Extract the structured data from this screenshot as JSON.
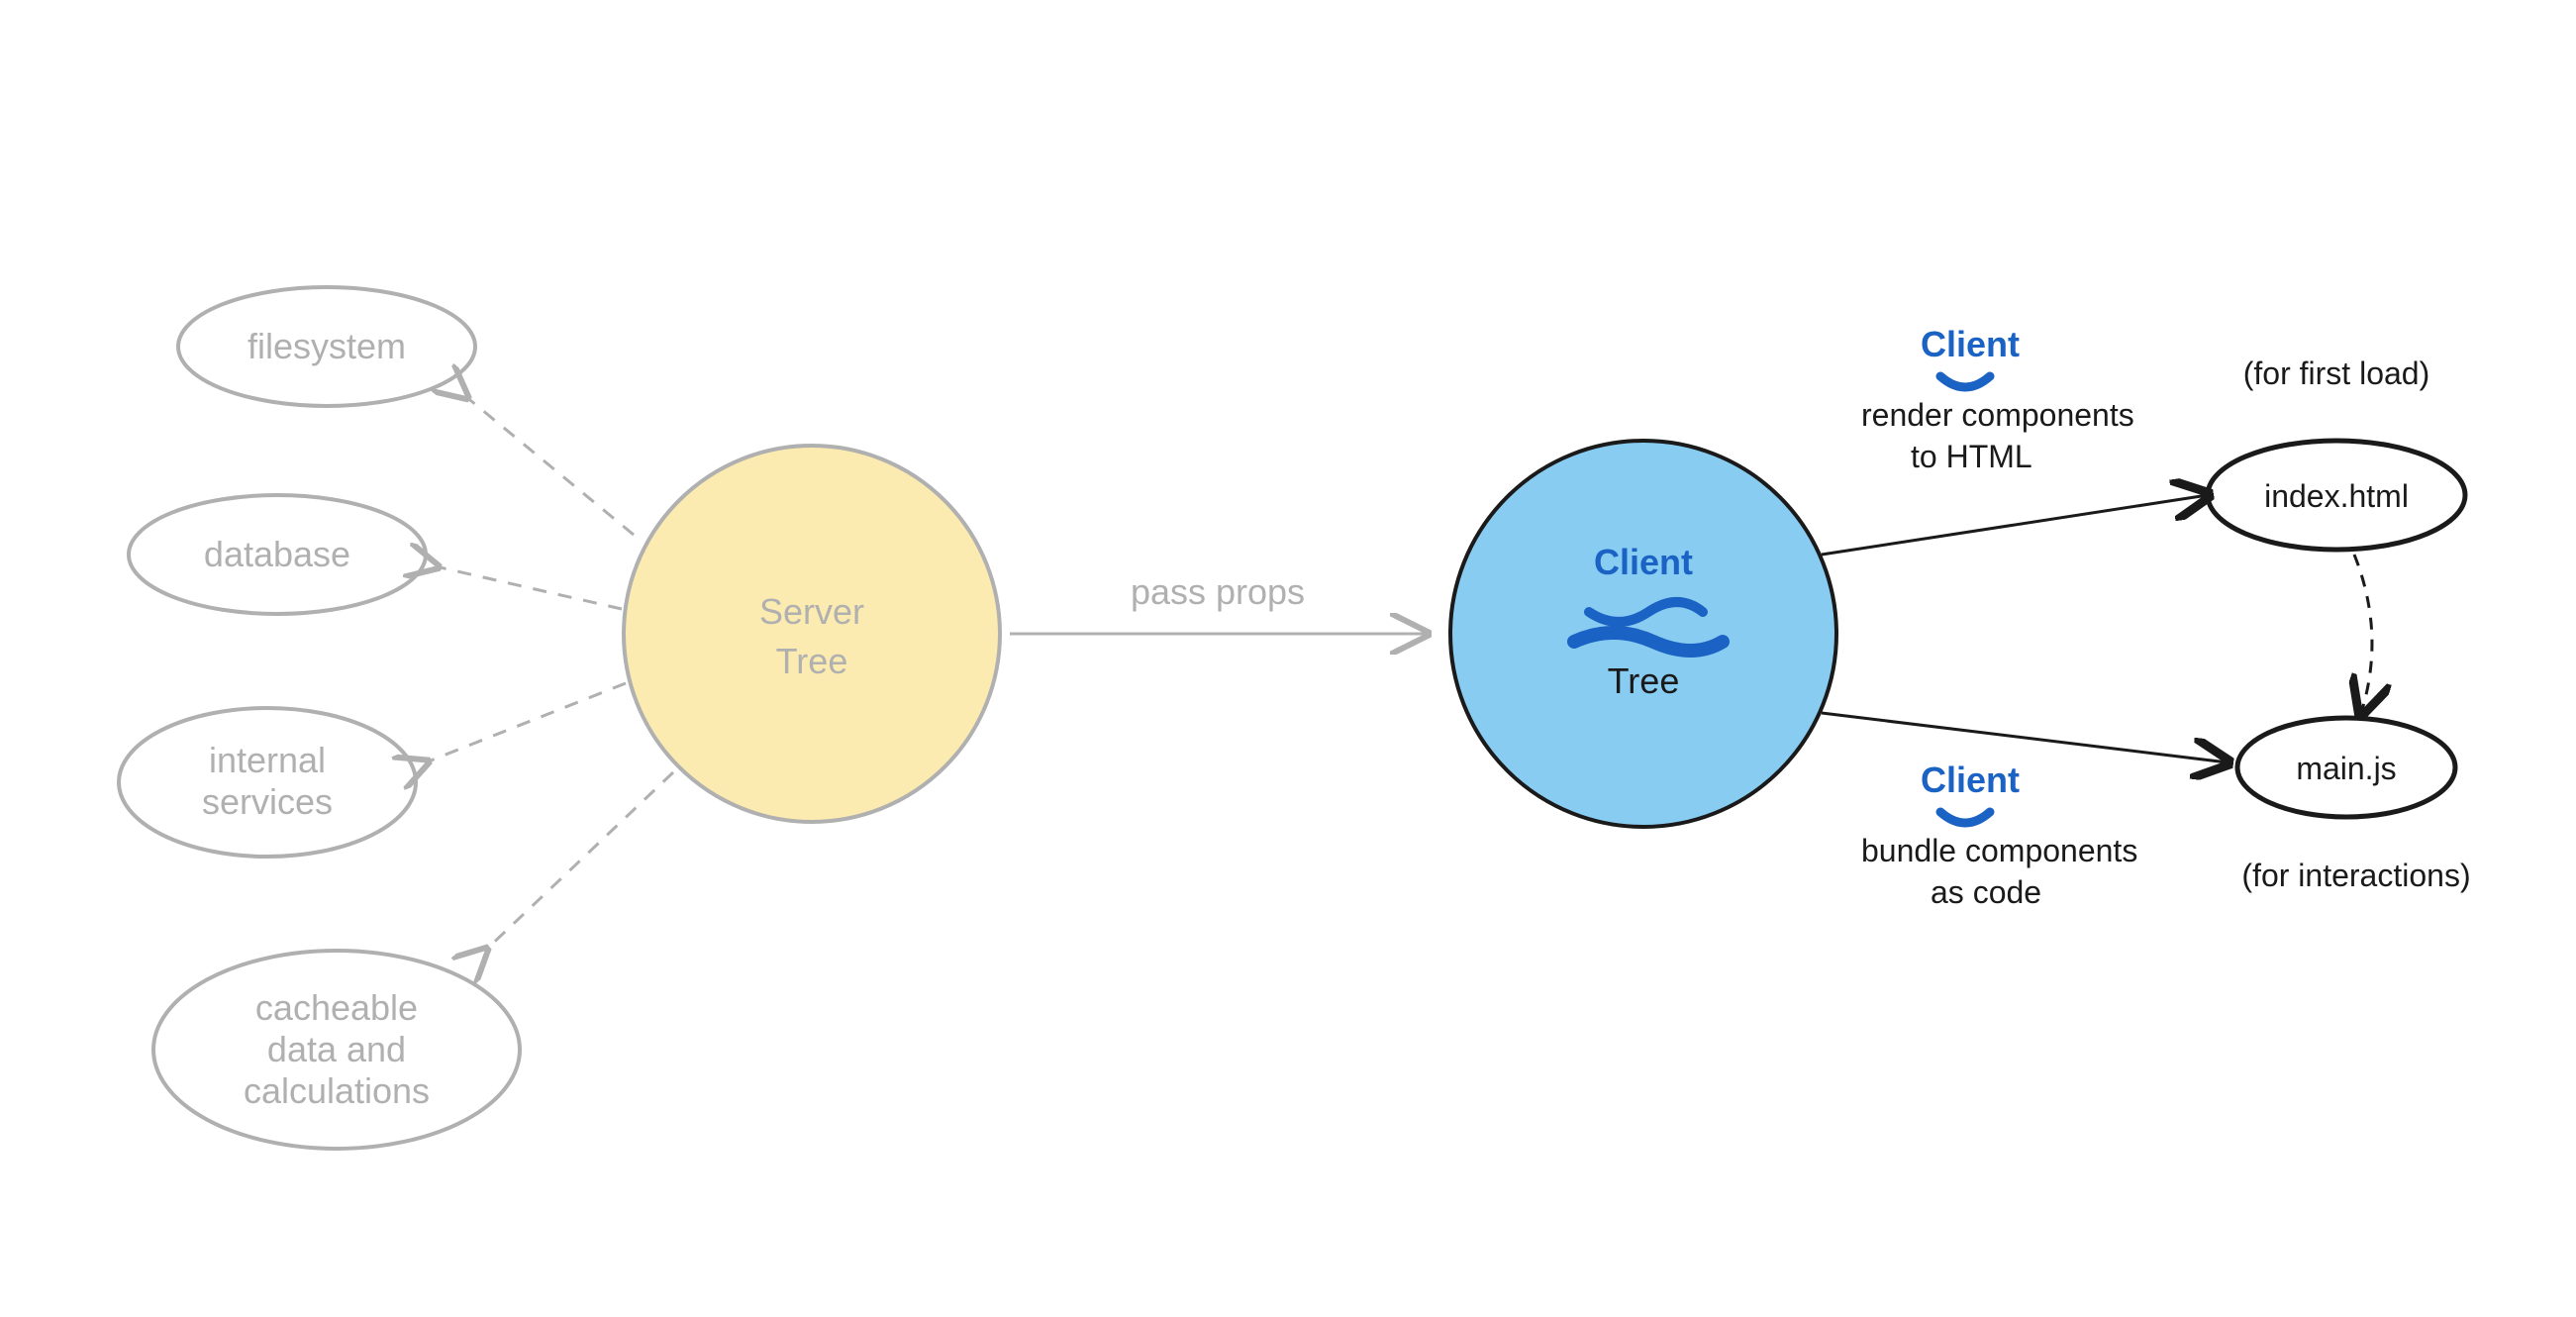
{
  "server_tree": {
    "label_line1": "Server",
    "label_line2": "Tree",
    "sources": [
      "filesystem",
      "database",
      "internal services",
      "cacheable data and calculations"
    ]
  },
  "pass_props_label": "pass props",
  "client_tree": {
    "annotation": "Client",
    "label_line2": "Tree"
  },
  "render_branch": {
    "annotation": "Client",
    "line1": "render components",
    "line2": "to HTML"
  },
  "bundle_branch": {
    "annotation": "Client",
    "line1": "bundle components",
    "line2": "as code"
  },
  "outputs": {
    "index_html": {
      "label": "index.html",
      "note": "(for first load)"
    },
    "main_js": {
      "label": "main.js",
      "note": "(for interactions)"
    }
  },
  "colors": {
    "server_fill": "#fbebb0",
    "client_fill": "#89ccf1",
    "grey_stroke": "#b0b0b0",
    "black_stroke": "#1a1a1a",
    "blue": "#1a62c4"
  }
}
